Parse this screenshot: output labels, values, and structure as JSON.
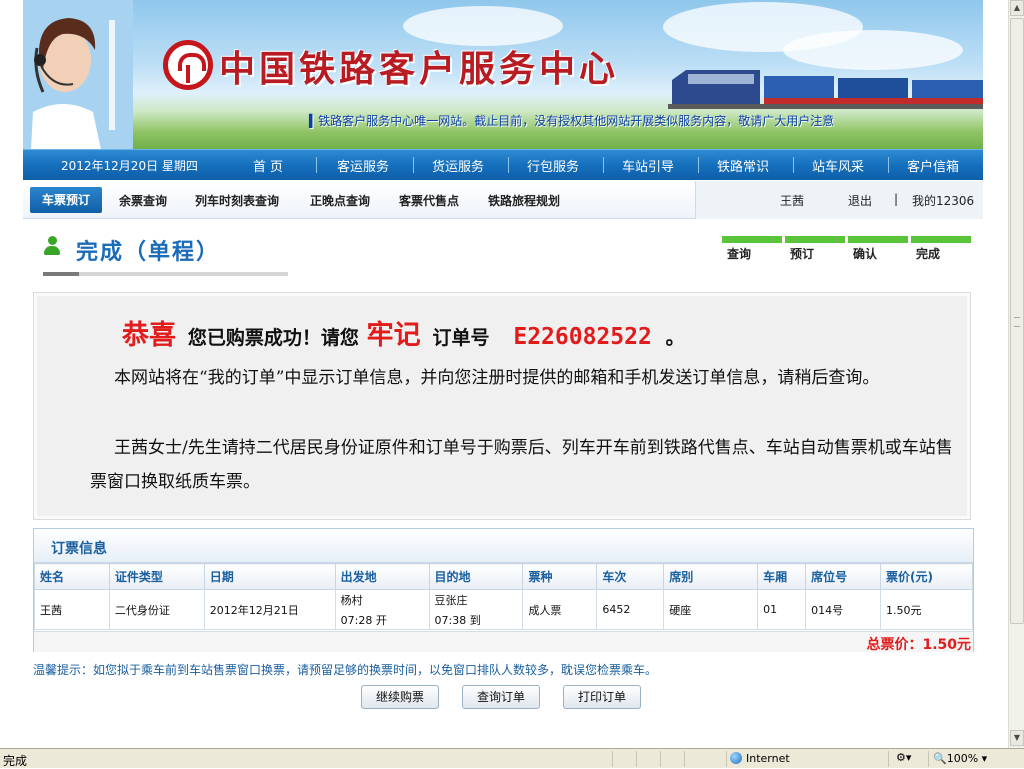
{
  "banner": {
    "site_title": "中国铁路客户服务中心",
    "notice": "▍铁路客户服务中心唯一网站。截止目前，没有授权其他网站开展类似服务内容，敬请广大用户注意"
  },
  "main_nav": {
    "date": "2012年12月20日 星期四",
    "items": [
      "首 页",
      "客运服务",
      "货运服务",
      "行包服务",
      "车站引导",
      "铁路常识",
      "站车风采",
      "客户信箱"
    ]
  },
  "sub_nav": {
    "active": "车票预订",
    "items": [
      "余票查询",
      "列车时刻表查询",
      "正晚点查询",
      "客票代售点",
      "铁路旅程规划"
    ],
    "user": "王茜",
    "logout": "退出",
    "divider": "|",
    "my12306": "我的12306"
  },
  "page": {
    "title": "完成（单程）",
    "steps": [
      "查询",
      "预订",
      "确认",
      "完成"
    ]
  },
  "message": {
    "congrats": "恭喜",
    "text1": "您已购票成功！请您",
    "remember": "牢记",
    "text2": "订单号",
    "order_no": "E226082522",
    "end": "。",
    "para1": "本网站将在“我的订单”中显示订单信息，并向您注册时提供的邮箱和手机发送订单信息，请稍后查询。",
    "para2": "王茜女士/先生请持二代居民身份证原件和订单号于购票后、列车开车前到铁路代售点、车站自动售票机或车站售票窗口换取纸质车票。"
  },
  "ticket": {
    "section_title": "订票信息",
    "headers": [
      "姓名",
      "证件类型",
      "日期",
      "出发地",
      "目的地",
      "票种",
      "车次",
      "席别",
      "车厢",
      "席位号",
      "票价(元)"
    ],
    "row": {
      "name": "王茜",
      "id_type": "二代身份证",
      "date": "2012年12月21日",
      "from_station": "杨村",
      "from_time": "07:28 开",
      "to_station": "豆张庄",
      "to_time": "07:38 到",
      "ticket_type": "成人票",
      "train_no": "6452",
      "seat_class": "硬座",
      "car": "01",
      "seat_no": "014号",
      "price": "1.50元"
    },
    "total": "总票价：1.50元"
  },
  "tip": "温馨提示：如您拟于乘车前到车站售票窗口换票，请预留足够的换票时间，以免窗口排队人数较多，耽误您检票乘车。",
  "buttons": {
    "continue": "继续购票",
    "query": "查询订单",
    "print": "打印订单"
  },
  "status_bar": {
    "text": "完成",
    "zone": "Internet",
    "zoom": "100%"
  },
  "colors": {
    "brand_red": "#c4161c",
    "nav_blue": "#1670bd",
    "step_green": "#59c33a",
    "highlight_red": "#e21b1b"
  }
}
